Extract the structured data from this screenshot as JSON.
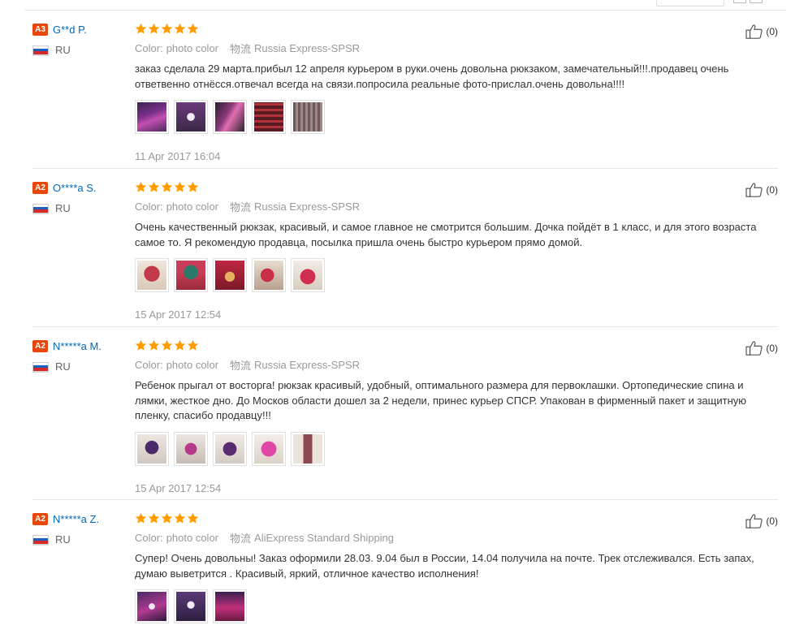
{
  "labels": {
    "color": "Color:",
    "shipping": "物流"
  },
  "reviews": [
    {
      "level": "A3",
      "name": "G**d P.",
      "country": "RU",
      "rating": 5,
      "color_value": "photo color",
      "shipping_value": "Russia Express-SPSR",
      "text": "заказ сделала 29 марта.прибыл 12 апреля курьером в руки.очень довольна рюкзаком, замечательный!!!.продавец очень ответвенно отнёсся.отвечал всегда на связи.попросила реальные фото-прислал.очень довольна!!!!",
      "photos": [
        "purple-backpack",
        "purple-backpack-unicorn",
        "purple-backpack-side",
        "dark-backpack",
        "grey-backpack"
      ],
      "date": "11 Apr 2017 16:04",
      "helpful": "(0)"
    },
    {
      "level": "A2",
      "name": "O****a S.",
      "country": "RU",
      "rating": 5,
      "color_value": "photo color",
      "shipping_value": "Russia Express-SPSR",
      "text": "Очень качественный рюкзак, красивый, и самое главное не смотрится большим. Дочка пойдёт в 1 класс, и для этого возраста самое то. Я рекомендую продавца, посылка пришла очень быстро курьером прямо домой.",
      "photos": [
        "red-backpack",
        "teal-backpack",
        "red-backpack-toy",
        "red-backpack-worn",
        "red-backpack-back"
      ],
      "date": "15 Apr 2017 12:54",
      "helpful": "(0)"
    },
    {
      "level": "A2",
      "name": "N*****a M.",
      "country": "RU",
      "rating": 5,
      "color_value": "photo color",
      "shipping_value": "Russia Express-SPSR",
      "text": "Ребенок прыгал от восторга! рюкзак красивый, удобный, оптимального размера для первоклашки. Ортопедические спина и лямки, жесткое дно. До Москов области дошел за 2 недели, принес курьер СПСР. Упакован в фирменный пакет и защитную пленку, спасибо продавцу!!!",
      "photos": [
        "purple-backpack-front",
        "purple-backpack-angle",
        "purple-backpack-print",
        "pink-backpack-hood",
        "backpack-straps"
      ],
      "date": "15 Apr 2017 12:54",
      "helpful": "(0)"
    },
    {
      "level": "A2",
      "name": "N*****a Z.",
      "country": "RU",
      "rating": 5,
      "color_value": "photo color",
      "shipping_value": "AliExpress Standard Shipping",
      "text": "Супер! Очень довольны! Заказ оформили 28.03. 9.04 был в России, 14.04 получила на почте. Трек отслеживался. Есть запах, думаю выветрится . Красивый, яркий, отличное качество исполнения!",
      "photos": [
        "purple-backpack-unicorn",
        "purple-backpack-print",
        "pink-backpack"
      ],
      "date": "",
      "helpful": "(0)"
    }
  ],
  "colors": {
    "badge": "#e8470c",
    "username": "#0069bb",
    "star": "#ff9a00",
    "muted": "#999999"
  }
}
